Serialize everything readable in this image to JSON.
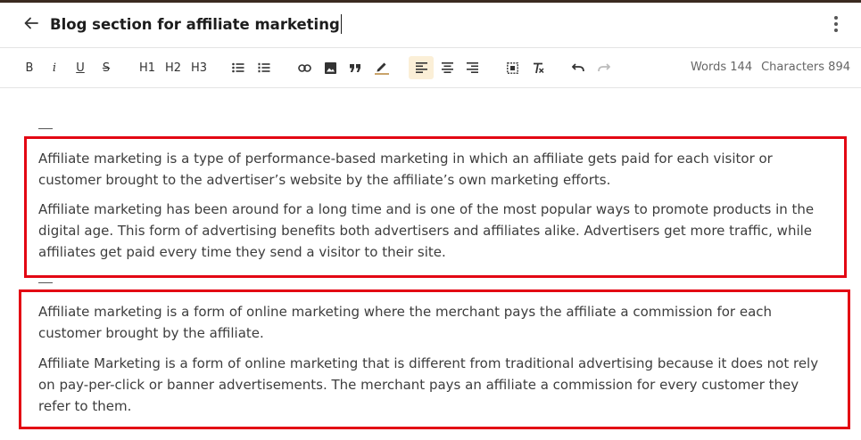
{
  "header": {
    "back_icon": "arrow-left-icon",
    "title": "Blog section for affiliate marketing",
    "menu_icon": "more-vertical-icon"
  },
  "toolbar": {
    "bold": "B",
    "italic": "i",
    "underline": "U",
    "strike": "S",
    "h1": "H1",
    "h2": "H2",
    "h3": "H3",
    "icons": [
      "bullet-list-icon",
      "numbered-list-icon",
      "link-icon",
      "image-icon",
      "quote-icon",
      "highlight-pen-icon",
      "align-left-icon",
      "align-center-icon",
      "align-right-icon",
      "select-all-icon",
      "clear-format-icon",
      "undo-icon",
      "redo-icon"
    ],
    "active_item": "align-left",
    "words": "Words 144",
    "characters": "Characters 894"
  },
  "sections": [
    {
      "paragraphs": [
        "Affiliate marketing is a type of performance-based marketing in which an affiliate gets paid for each visitor or customer brought to the advertiser’s website by the affiliate’s own marketing efforts.",
        "Affiliate marketing has been around for a long time and is one of the most popular ways to promote products in the digital age. This form of advertising benefits both advertisers and affiliates alike. Advertisers get more traffic, while affiliates get paid every time they send a visitor to their site."
      ]
    },
    {
      "paragraphs": [
        "Affiliate marketing is a form of online marketing where the merchant pays the affiliate a commission for each customer brought by the affiliate.",
        "Affiliate Marketing is a form of online marketing that is different from traditional advertising because it does not rely on pay-per-click or banner advertisements. The merchant pays an affiliate a commission for every customer they refer to them."
      ]
    }
  ],
  "colors": {
    "highlight_box": "#e30613",
    "active_button_bg": "#fbefd7",
    "top_border": "#3b2a20"
  }
}
